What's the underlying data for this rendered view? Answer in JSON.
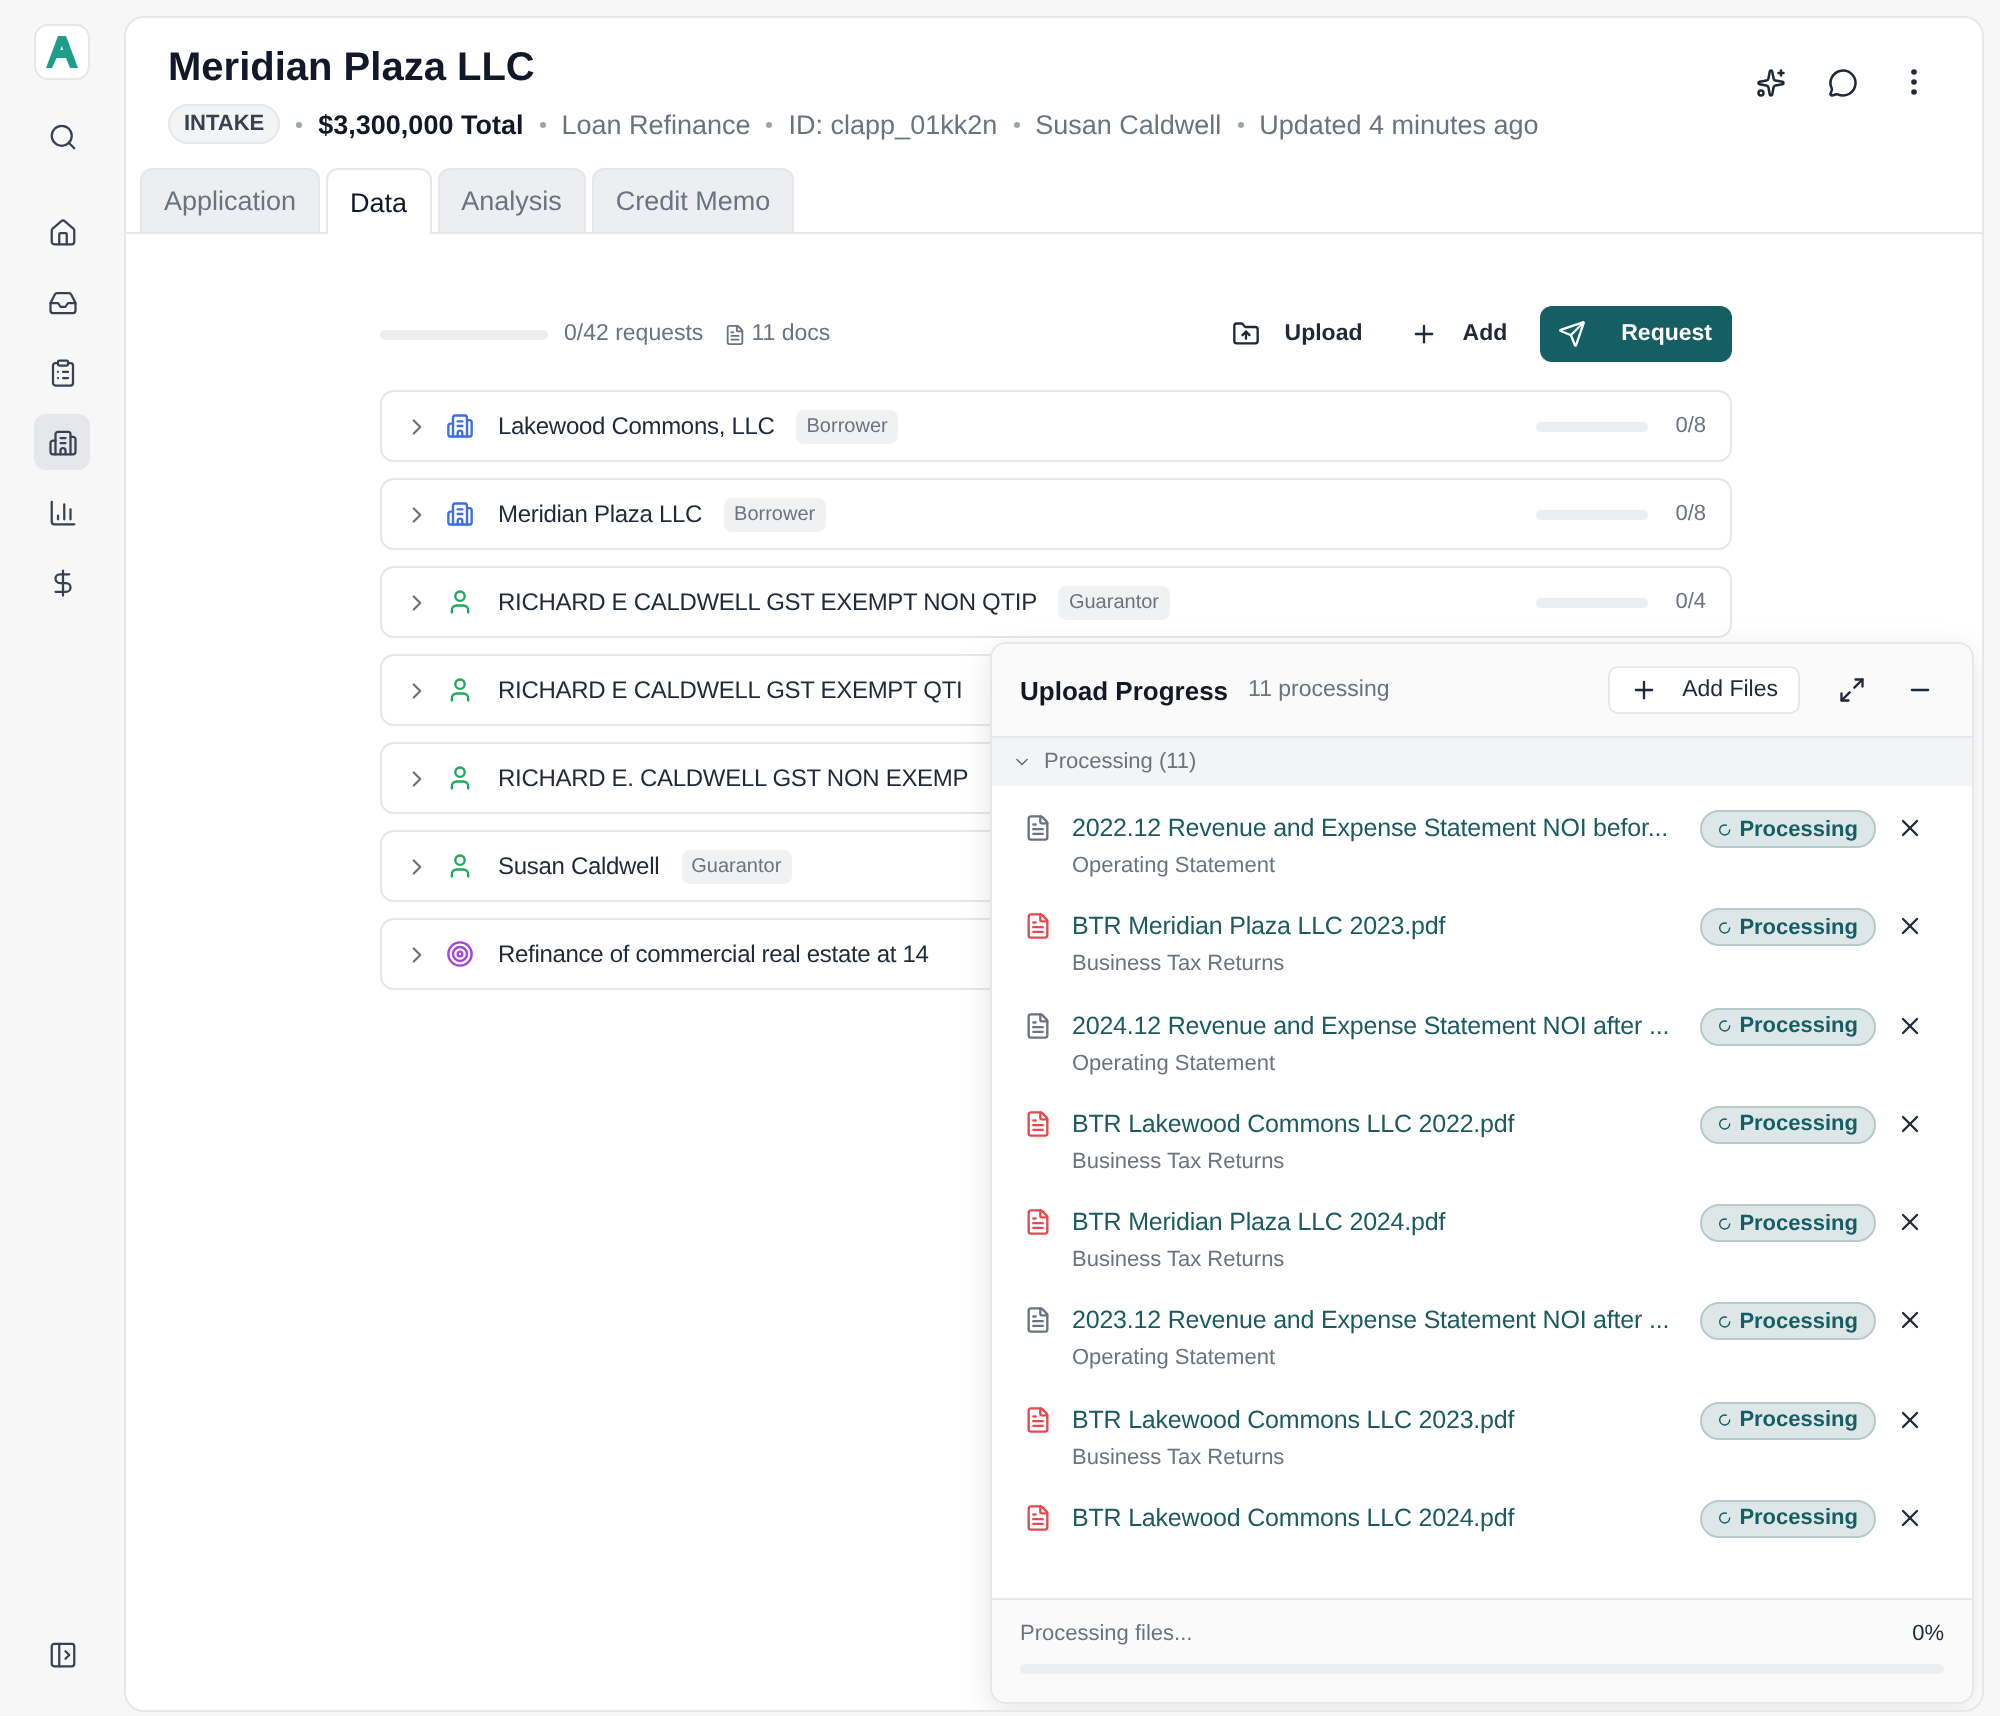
{
  "sidebar": {
    "items": [
      {
        "kind": "search",
        "selected": false
      },
      {
        "kind": "home",
        "selected": false
      },
      {
        "kind": "inbox",
        "selected": false
      },
      {
        "kind": "clipboard",
        "selected": false
      },
      {
        "kind": "building",
        "selected": true
      },
      {
        "kind": "chart",
        "selected": false
      },
      {
        "kind": "dollar",
        "selected": false
      }
    ]
  },
  "header": {
    "title": "Meridian Plaza LLC",
    "status": "INTAKE",
    "meta": [
      {
        "kind": "amount",
        "text": "$3,300,000 Total"
      },
      {
        "kind": "info",
        "text": "Loan Refinance"
      },
      {
        "kind": "info",
        "text": "ID: clapp_01kk2n"
      },
      {
        "kind": "info",
        "text": "Susan Caldwell"
      },
      {
        "kind": "info",
        "text": "Updated 4 minutes ago"
      }
    ]
  },
  "tabs": [
    {
      "label": "Application",
      "selected": false
    },
    {
      "label": "Data",
      "selected": true
    },
    {
      "label": "Analysis",
      "selected": false
    },
    {
      "label": "Credit Memo",
      "selected": false
    }
  ],
  "toolbar": {
    "level": 0,
    "requests": "0/42 requests",
    "docs": "11 docs",
    "buttons": [
      {
        "kind": "upload",
        "label": "Upload"
      },
      {
        "kind": "add",
        "label": "Add"
      },
      {
        "kind": "request",
        "label": "Request"
      }
    ]
  },
  "entities": [
    {
      "kind": "building",
      "name": "Lakewood Commons, LLC",
      "badge": "Borrower",
      "level": 0,
      "count": "0/8"
    },
    {
      "kind": "building",
      "name": "Meridian Plaza LLC",
      "badge": "Borrower",
      "level": 0,
      "count": "0/8"
    },
    {
      "kind": "person",
      "name": "RICHARD E CALDWELL GST EXEMPT NON QTIP",
      "badge": "Guarantor",
      "level": 0,
      "count": "0/4"
    },
    {
      "kind": "person",
      "name": "RICHARD E CALDWELL GST EXEMPT QTI"
    },
    {
      "kind": "person",
      "name": "RICHARD E. CALDWELL GST NON EXEMP"
    },
    {
      "kind": "person",
      "name": "Susan Caldwell",
      "badge": "Guarantor"
    },
    {
      "kind": "target",
      "name": "Refinance of commercial real estate at 14"
    }
  ],
  "upload_panel": {
    "title": "Upload Progress",
    "count": "11 processing",
    "add_files": "Add Files",
    "group": {
      "label": "Processing (11)",
      "expanded": true
    },
    "files": [
      {
        "kind": "doc",
        "name": "2022.12 Revenue and Expense Statement NOI befor...",
        "category": "Operating Statement",
        "status": "Processing"
      },
      {
        "kind": "pdf",
        "name": "BTR Meridian Plaza LLC 2023.pdf",
        "category": "Business Tax Returns",
        "status": "Processing"
      },
      {
        "kind": "doc",
        "name": "2024.12 Revenue and Expense Statement NOI after ...",
        "category": "Operating Statement",
        "status": "Processing"
      },
      {
        "kind": "pdf",
        "name": "BTR Lakewood Commons LLC 2022.pdf",
        "category": "Business Tax Returns",
        "status": "Processing"
      },
      {
        "kind": "pdf",
        "name": "BTR Meridian Plaza LLC 2024.pdf",
        "category": "Business Tax Returns",
        "status": "Processing"
      },
      {
        "kind": "doc",
        "name": "2023.12 Revenue and Expense Statement NOI after ...",
        "category": "Operating Statement",
        "status": "Processing"
      },
      {
        "kind": "pdf",
        "name": "BTR Lakewood Commons LLC 2023.pdf",
        "category": "Business Tax Returns",
        "status": "Processing"
      },
      {
        "kind": "pdf",
        "name": "BTR Lakewood Commons LLC 2024.pdf",
        "status": "Processing"
      }
    ],
    "footer": {
      "text": "Processing files...",
      "percent": "0%",
      "level": 0
    }
  }
}
